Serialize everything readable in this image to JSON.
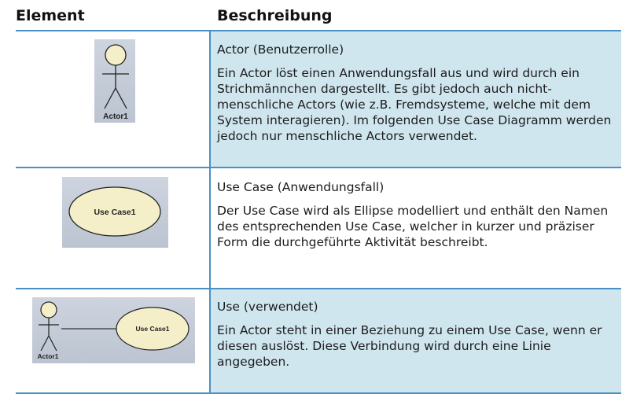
{
  "header": {
    "element": "Element",
    "description": "Beschreibung"
  },
  "rows": [
    {
      "title": "Actor (Benutzerrolle)",
      "text": "Ein Actor löst einen Anwendungsfall aus und wird durch ein Strichmännchen dargestellt. Es gibt jedoch auch nicht-menschliche Actors (wie z.B. Fremdsysteme, welche mit dem System interagieren). Im folgenden Use Case Diagramm werden jedoch nur menschliche Actors verwendet.",
      "image_label": "Actor1"
    },
    {
      "title": "Use Case (Anwendungsfall)",
      "text": "Der Use Case wird als Ellipse modelliert und enthält den Namen des entsprechenden Use Case, welcher in kurzer und präziser Form die durchgeführte Aktivität beschreibt.",
      "image_label": "Use Case1"
    },
    {
      "title": "Use (verwendet)",
      "text": "Ein Actor steht in einer Beziehung zu einem Use Case, wenn er diesen auslöst. Diese Verbindung wird durch eine Linie angegeben.",
      "image_label_actor": "Actor1",
      "image_label_usecase": "Use Case1"
    }
  ],
  "colors": {
    "shaded_row": "#cfe6ef",
    "rule": "#4a90c4",
    "image_bg": "#c7cfdb",
    "ellipse_fill": "#f4efc8"
  }
}
